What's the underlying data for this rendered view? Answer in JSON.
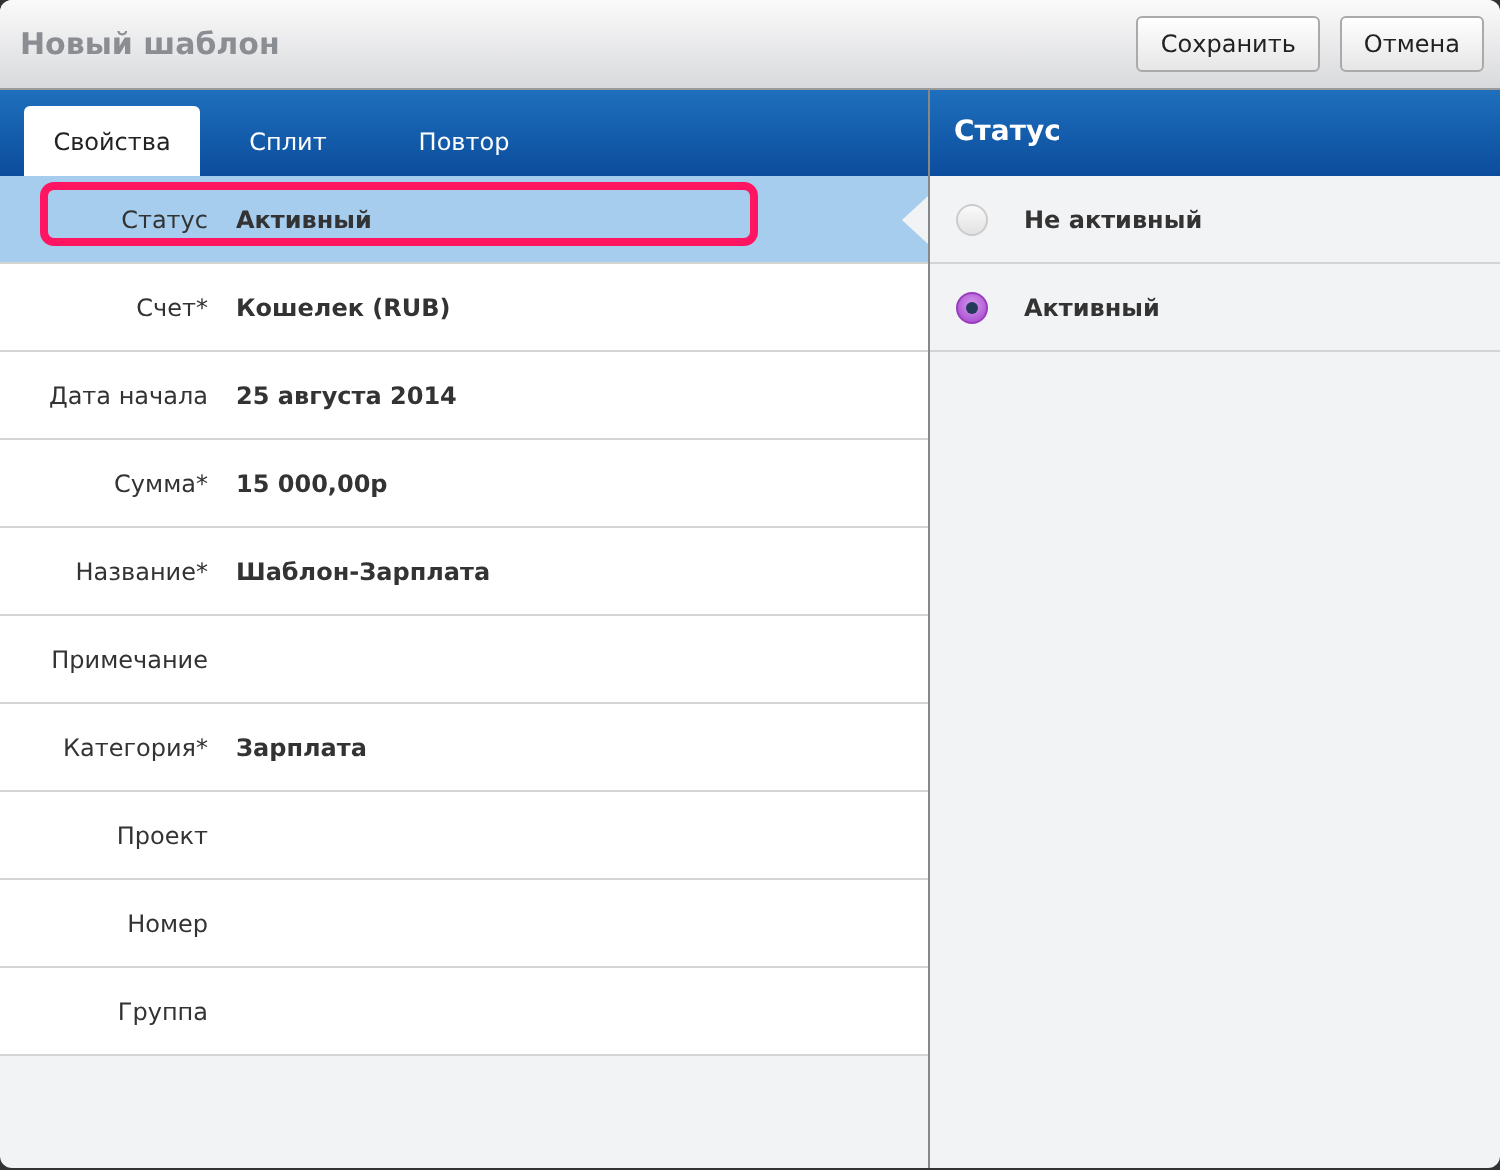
{
  "window": {
    "title": "Новый шаблон"
  },
  "buttons": [
    {
      "label": "Сохранить"
    },
    {
      "label": "Отмена"
    }
  ],
  "tabs": [
    {
      "label": "Свойства",
      "selected": true
    },
    {
      "label": "Сплит",
      "selected": false
    },
    {
      "label": "Повтор",
      "selected": false
    }
  ],
  "fields": [
    {
      "label": "Статус",
      "value": "Активный",
      "selected": true,
      "highlighted": true
    },
    {
      "label": "Счет*",
      "value": "Кошелек (RUB)",
      "selected": false,
      "highlighted": false
    },
    {
      "label": "Дата начала",
      "value": "25 августа 2014",
      "selected": false,
      "highlighted": false
    },
    {
      "label": "Сумма*",
      "value": "15 000,00р",
      "selected": false,
      "highlighted": false
    },
    {
      "label": "Название*",
      "value": "Шаблон-Зарплата",
      "selected": false,
      "highlighted": false
    },
    {
      "label": "Примечание",
      "selected": false,
      "highlighted": false
    },
    {
      "label": "Категория*",
      "value": "Зарплата",
      "selected": false,
      "highlighted": false
    },
    {
      "label": "Проект",
      "selected": false,
      "highlighted": false
    },
    {
      "label": "Номер",
      "selected": false,
      "highlighted": false
    },
    {
      "label": "Группа",
      "selected": false,
      "highlighted": false
    }
  ],
  "panel": {
    "title": "Статус",
    "options": [
      {
        "label": "Не активный",
        "selected": false
      },
      {
        "label": "Активный",
        "selected": true
      }
    ]
  }
}
